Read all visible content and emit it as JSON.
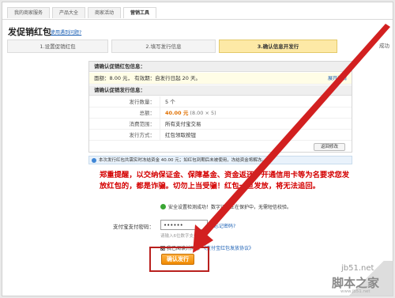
{
  "topnav": {
    "tabs": [
      "我的商家服务",
      "产品大全",
      "商家活动",
      "营销工具"
    ],
    "active_index": 3
  },
  "title": "发促销红包",
  "help_link": "使用遇到问题?",
  "steps": [
    "1.设置促销红包",
    "2.填写发行信息",
    "3.确认信息开发行",
    "成功"
  ],
  "panel": {
    "head1": "请确认促销红包信息：",
    "face_value_line": "面额：8.00 元， 有效期：自发行日起 20 天。",
    "edit_link": "展开详情",
    "head2": "请确认促销发行信息：",
    "rows": [
      {
        "label": "发行数量：",
        "value": "5 个"
      },
      {
        "label": "总额：",
        "amount": "40.00 元",
        "sub": "(8.00 × 5)"
      },
      {
        "label": "消费范围：",
        "value": "所有支付宝交易"
      },
      {
        "label": "发行方式：",
        "value": "红包领取按钮"
      }
    ],
    "back_button": "返回修改"
  },
  "notice": "本次发行红包共需实时冻结资金 40.00 元；如红包到期后未被使用，冻结资金将解冻。",
  "warning": "郑重提醒，以交纳保证金、保障基金、资金返还、开通信用卡等为名要求您发放红包的，都是诈骗。切勿上当受骗！红包一旦发放，将无法追回。",
  "security": "安全设置检测成功！数字证书正在保护中，无需短信校验。",
  "password": {
    "label": "支付宝支付密码：",
    "value": "••••••",
    "forgot": "忘记密码?",
    "hint": "请输入6位数字支付密码"
  },
  "agree": {
    "text": "我已阅读并同意",
    "link": "《支付宝红包发放协议》"
  },
  "confirm_button": "确认发行",
  "watermark": {
    "site": "jb51.net",
    "name": "脚本之家",
    "url": "www.jb51.net"
  },
  "colors": {
    "active_step": "#fde9a6",
    "warning_text": "#d40000",
    "confirm_button": "#f08a00",
    "highlight_box": "#b9201e"
  }
}
